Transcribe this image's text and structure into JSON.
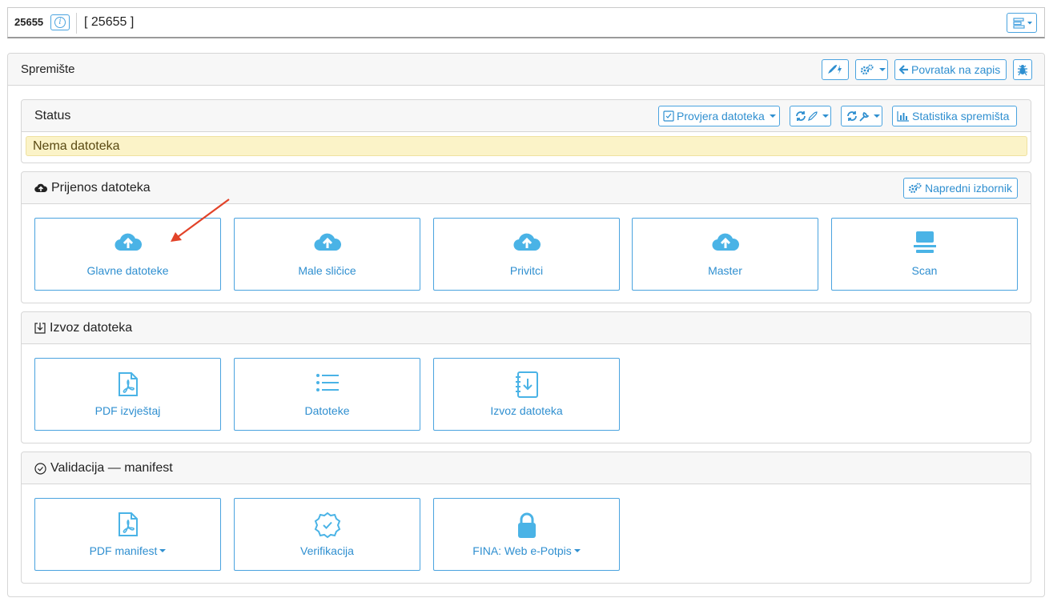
{
  "record": {
    "id": "25655",
    "title": "[ 25655 ]",
    "info_icon": "info-icon",
    "menu_icon": "menu-bars-icon"
  },
  "panel": {
    "title": "Spremište",
    "buttons": {
      "quick": "rocket-bolt-icon",
      "settings": "gears-icon",
      "back_label": "Povratak na zapis",
      "debug": "bug-icon"
    }
  },
  "status": {
    "title": "Status",
    "check_label": "Provjera datoteka",
    "refresh_rocket": "refresh-rocket-icon",
    "refresh_wrench": "refresh-wrench-icon",
    "stats_label": "Statistika spremišta",
    "alert": "Nema datoteka"
  },
  "upload": {
    "title": "Prijenos datoteka",
    "advanced_label": "Napredni izbornik",
    "tiles": [
      {
        "label": "Glavne datoteke",
        "icon": "cloud-upload-icon"
      },
      {
        "label": "Male sličice",
        "icon": "cloud-upload-icon"
      },
      {
        "label": "Privitci",
        "icon": "cloud-upload-icon"
      },
      {
        "label": "Master",
        "icon": "cloud-upload-icon"
      },
      {
        "label": "Scan",
        "icon": "scanner-icon"
      }
    ]
  },
  "export": {
    "title": "Izvoz datoteka",
    "tiles": [
      {
        "label": "PDF izvještaj",
        "icon": "pdf-file-icon"
      },
      {
        "label": "Datoteke",
        "icon": "list-icon"
      },
      {
        "label": "Izvoz datoteka",
        "icon": "notebook-download-icon"
      }
    ]
  },
  "validation": {
    "title": "Validacija — manifest",
    "tiles": [
      {
        "label": "PDF manifest",
        "icon": "pdf-file-icon"
      },
      {
        "label": "Verifikacija",
        "icon": "badge-check-icon"
      },
      {
        "label": "FINA: Web e-Potpis",
        "icon": "lock-icon"
      }
    ]
  },
  "colors": {
    "accent": "#2f8fd0",
    "accent_border": "#4aa3df",
    "icon": "#4ab3e6",
    "alert_bg": "#fbf3c8",
    "annotation": "#e24329"
  }
}
